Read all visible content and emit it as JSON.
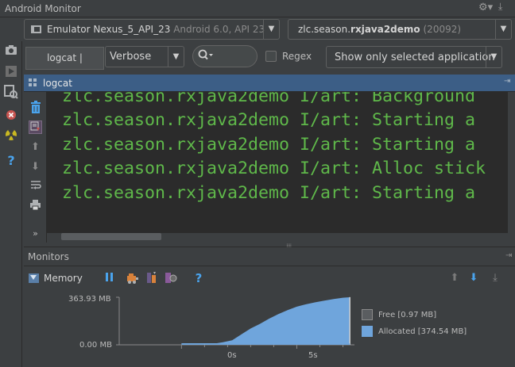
{
  "window": {
    "title": "Android Monitor"
  },
  "device": {
    "name": "Emulator Nexus_5_API_23",
    "detail": "Android 6.0, API 23"
  },
  "app": {
    "package_prefix": "zlc.season.",
    "package_bold": "rxjava2demo",
    "pid": "(20092)"
  },
  "tabs": {
    "active": "logcat | Monitors"
  },
  "logcat": {
    "level": "Verbose",
    "search_value": "",
    "regex_label": "Regex",
    "filter": "Show only selected application",
    "header": "logcat",
    "lines": [
      "zlc.season.rxjava2demo I/art: Background",
      "zlc.season.rxjava2demo I/art: Starting a",
      "zlc.season.rxjava2demo I/art: Starting a",
      "zlc.season.rxjava2demo I/art: Alloc stick",
      "zlc.season.rxjava2demo I/art: Starting a"
    ]
  },
  "monitors": {
    "header": "Monitors",
    "memory_label": "Memory",
    "chart_data": {
      "type": "area",
      "title": "",
      "xlabel": "",
      "ylabel": "",
      "y_ticks": [
        "363.93 MB",
        "0.00 MB"
      ],
      "x_ticks": [
        "0s",
        "5s"
      ],
      "ylim": [
        0,
        363.93
      ],
      "x": [
        0.0,
        0.7,
        1.4,
        1.8,
        2.2,
        2.6,
        3.0,
        3.4,
        3.8,
        4.2,
        4.6,
        5.0,
        5.4,
        5.8,
        6.2,
        6.6,
        7.0,
        7.3
      ],
      "series": [
        {
          "name": "Free [0.97 MB]",
          "color": "#5a5d60",
          "values": [
            0,
            0,
            0,
            0,
            0,
            0,
            0,
            0,
            0,
            0,
            0,
            0,
            0,
            0,
            0,
            0,
            0,
            1
          ]
        },
        {
          "name": "Allocated [374.54 MB]",
          "color": "#6fa5dc",
          "values": [
            0,
            0,
            8,
            20,
            35,
            80,
            125,
            160,
            200,
            235,
            265,
            292,
            310,
            325,
            338,
            350,
            360,
            364
          ]
        }
      ],
      "grid": false,
      "legend": "right"
    }
  },
  "icons": [
    "camera-icon",
    "play-icon",
    "search-icon",
    "close-icon",
    "radioactive-icon",
    "help-icon",
    "trash-icon",
    "scroll-to-end-icon",
    "up-icon",
    "down-icon",
    "wrap-icon",
    "print-icon",
    "pause-icon",
    "gc-icon",
    "dump-icon",
    "alloc-icon",
    "settings-icon"
  ]
}
